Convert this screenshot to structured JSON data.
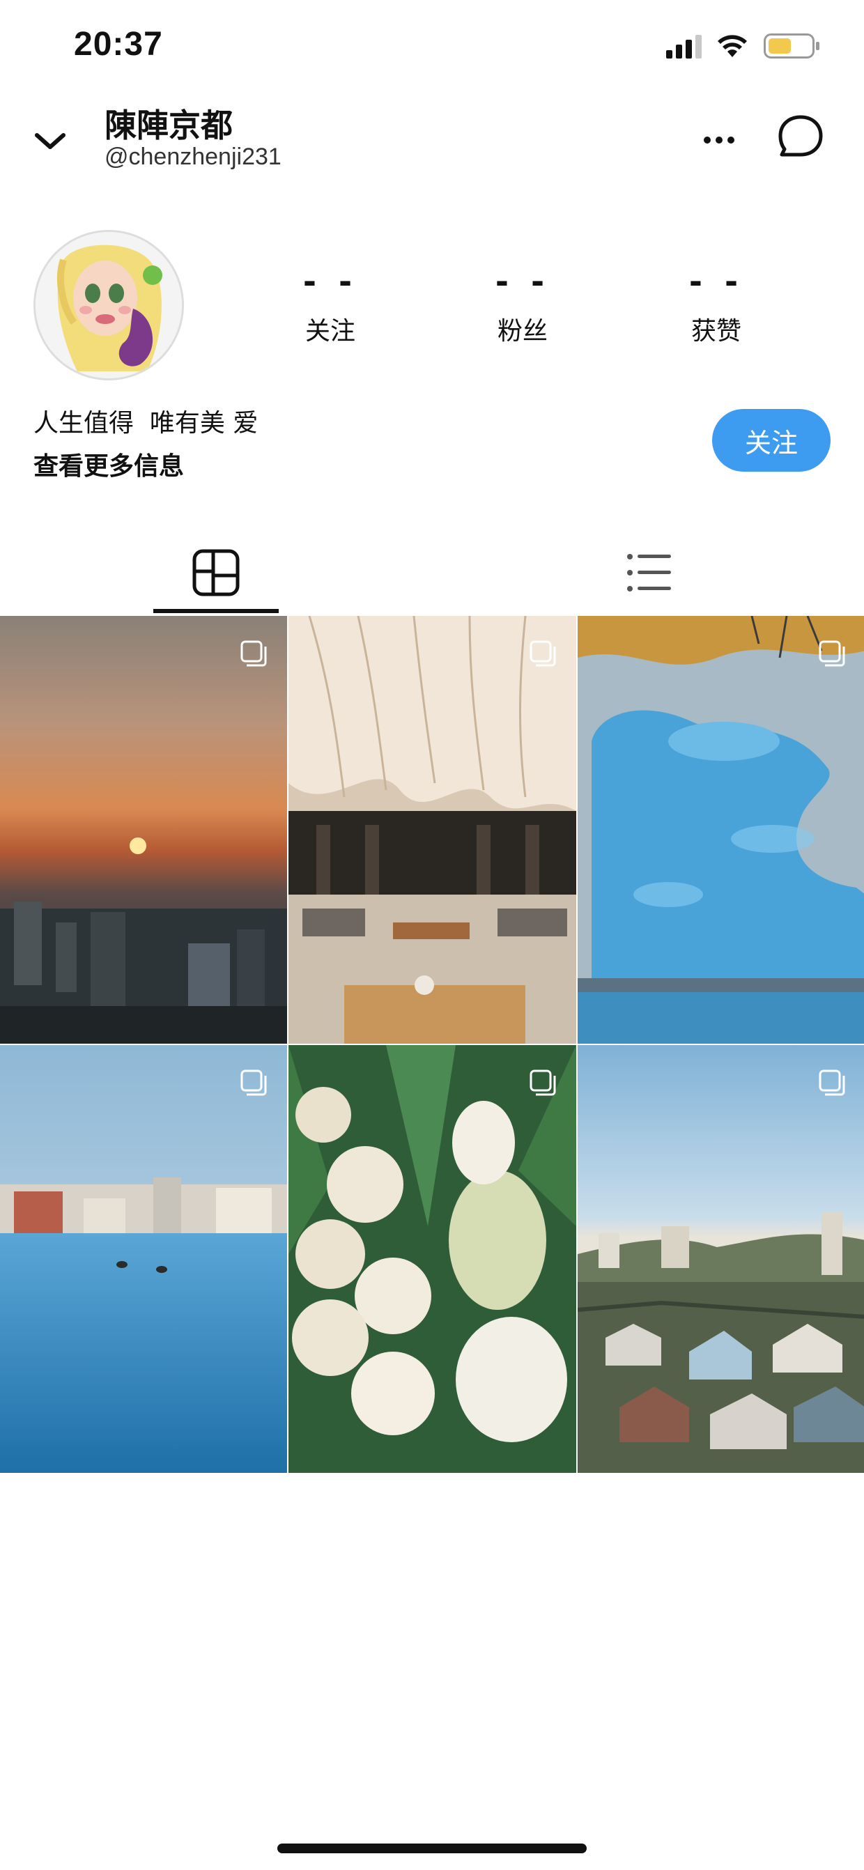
{
  "status_bar": {
    "time": "20:37"
  },
  "header": {
    "display_name": "陳陣京都",
    "handle": "@chenzhenji231"
  },
  "profile": {
    "stats": [
      {
        "value": "- -",
        "label": "关注"
      },
      {
        "value": "- -",
        "label": "粉丝"
      },
      {
        "value": "- -",
        "label": "获赞"
      }
    ],
    "bio": "人生值得  唯有美 爱",
    "more_info": "查看更多信息",
    "follow_label": "关注"
  },
  "colors": {
    "accent": "#3d9cf0",
    "battery_fill": "#f2c94c"
  },
  "icons": {
    "back": "chevron-down-icon",
    "more": "more-horizontal-icon",
    "message": "chat-bubble-icon",
    "grid_tab": "grid-layout-icon",
    "list_tab": "list-icon",
    "multi": "multi-image-icon"
  },
  "grid_items": [
    {
      "subject": "sunset"
    },
    {
      "subject": "lobby"
    },
    {
      "subject": "pool"
    },
    {
      "subject": "rooftop-pool"
    },
    {
      "subject": "lotus"
    },
    {
      "subject": "town"
    }
  ]
}
